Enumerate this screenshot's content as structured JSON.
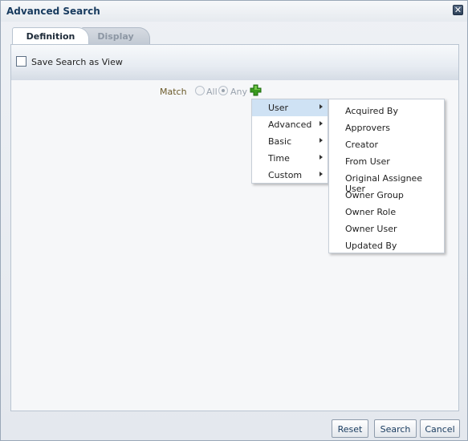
{
  "dialog": {
    "title": "Advanced Search",
    "close_symbol": "✕"
  },
  "tabs": [
    {
      "label": "Definition",
      "active": true
    },
    {
      "label": "Display",
      "active": false
    }
  ],
  "save_view": {
    "label": "Save Search as View",
    "checked": false
  },
  "match": {
    "label": "Match",
    "options": [
      {
        "label": "All",
        "selected": false
      },
      {
        "label": "Any",
        "selected": true
      }
    ]
  },
  "add_icon": {
    "name": "add-icon",
    "color": "#3a9a1e"
  },
  "menu": {
    "items": [
      {
        "label": "User",
        "highlighted": true
      },
      {
        "label": "Advanced",
        "highlighted": false
      },
      {
        "label": "Basic",
        "highlighted": false
      },
      {
        "label": "Time",
        "highlighted": false
      },
      {
        "label": "Custom",
        "highlighted": false
      }
    ]
  },
  "submenu": {
    "items": [
      "Acquired By",
      "Approvers",
      "Creator",
      "From User",
      "Original Assignee User",
      "Owner Group",
      "Owner Role",
      "Owner User",
      "Updated By"
    ]
  },
  "buttons": {
    "reset": "Reset",
    "search": "Search",
    "cancel": "Cancel"
  }
}
